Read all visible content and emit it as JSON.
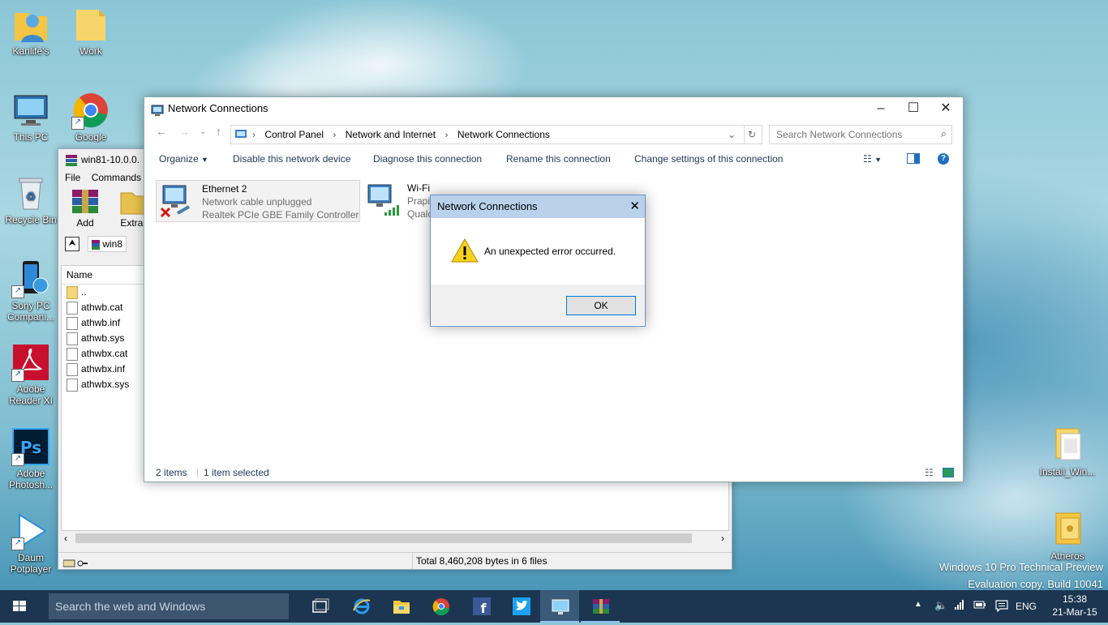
{
  "desktop": {
    "icons": [
      {
        "label": "Kanlife's",
        "icon": "user-folder-icon"
      },
      {
        "label": "Work",
        "icon": "folder-icon"
      },
      {
        "label": "This PC",
        "icon": "computer-icon"
      },
      {
        "label": "Google Chrome",
        "icon": "chrome-icon"
      },
      {
        "label": "Recycle Bin",
        "icon": "recycle-bin-icon"
      },
      {
        "label": "Sony PC Compani...",
        "icon": "sony-pc-companion-icon"
      },
      {
        "label": "Adobe Reader XI",
        "icon": "adobe-reader-icon"
      },
      {
        "label": "Adobe Photosh...",
        "icon": "photoshop-icon"
      },
      {
        "label": "Daum Potplayer",
        "icon": "potplayer-icon"
      },
      {
        "label": "Install_Win...",
        "icon": "install-file-icon"
      },
      {
        "label": "Atheros",
        "icon": "atheros-folder-icon"
      }
    ],
    "watermark_line1": "Windows 10 Pro Technical Preview",
    "watermark_line2": "Evaluation copy. Build 10041"
  },
  "winrar": {
    "title": "win81-10.0.0.",
    "menu": [
      "File",
      "Commands"
    ],
    "tools": [
      "Add",
      "Extract"
    ],
    "path": "win8",
    "column_name": "Name",
    "files": [
      "..",
      "athwb.cat",
      "athwb.inf",
      "athwb.sys",
      "athwbx.cat",
      "athwbx.inf",
      "athwbx.sys"
    ],
    "status": "Total 8,460,208 bytes in 6 files"
  },
  "netconn": {
    "title": "Network Connections",
    "breadcrumbs": [
      "Control Panel",
      "Network and Internet",
      "Network Connections"
    ],
    "search_placeholder": "Search Network Connections",
    "commands": {
      "organize": "Organize",
      "disable": "Disable this network device",
      "diagnose": "Diagnose this connection",
      "rename": "Rename this connection",
      "change": "Change settings of this connection"
    },
    "connections": [
      {
        "name": "Ethernet 2",
        "status": "Network cable unplugged",
        "adapter": "Realtek PCIe GBE Family Controller"
      },
      {
        "name": "Wi-Fi",
        "status": "Prapi",
        "adapter": "Qualc"
      }
    ],
    "status_items": "2 items",
    "status_selected": "1 item selected"
  },
  "dialog": {
    "title": "Network Connections",
    "message": "An unexpected error occurred.",
    "ok": "OK"
  },
  "taskbar": {
    "search_placeholder": "Search the web and Windows",
    "language": "ENG",
    "time": "15:38",
    "date": "21-Mar-15"
  },
  "colors": {
    "taskbar": "#1c3550",
    "dialog_title": "#b9d1ea",
    "accent": "#0078d7"
  }
}
